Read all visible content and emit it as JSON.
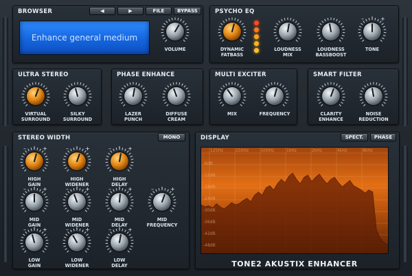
{
  "theme": {
    "accent_orange": "#f3961c",
    "screen_blue": "#1f76f0",
    "panel_dark": "#22282e"
  },
  "browser": {
    "title": "BROWSER",
    "prev_label": "◀",
    "next_label": "▶",
    "file_label": "FILE",
    "bypass_label": "BYPASS",
    "preset_name": "Enhance general medium",
    "volume_label": "VOLUME"
  },
  "psycho_eq": {
    "title": "PSYCHO EQ",
    "knobs": [
      "DYNAMIC\nFATBASS",
      "LOUDNESS\nMIX",
      "LOUDNESS\nBASSBOOST",
      "TONE"
    ]
  },
  "ultra_stereo": {
    "title": "ULTRA STEREO",
    "knobs": [
      "VIRTUAL\nSURROUND",
      "SILKY\nSURROUND"
    ]
  },
  "phase_enhance": {
    "title": "PHASE ENHANCE",
    "knobs": [
      "LAZER\nPUNCH",
      "DIFFUSE\nCREAM"
    ]
  },
  "multi_exciter": {
    "title": "MULTI EXCITER",
    "knobs": [
      "MIX",
      "FREQUENCY"
    ]
  },
  "smart_filter": {
    "title": "SMART FILTER",
    "knobs": [
      "CLARITY\nENHANCE",
      "NOISE\nREDUCTION"
    ]
  },
  "stereo_width": {
    "title": "STEREO WIDTH",
    "mono_label": "MONO",
    "knobs": [
      "HIGH\nGAIN",
      "HIGH\nWIDENER",
      "HIGH\nDELAY",
      "MID\nGAIN",
      "MID\nWIDENER",
      "MID\nDELAY",
      "MID\nFREQUENCY",
      "LOW\nGAIN",
      "LOW\nWIDENER",
      "LOW\nDELAY"
    ]
  },
  "display": {
    "title": "DISPLAY",
    "spect_label": "SPECT.",
    "phase_label": "PHASE",
    "freq_labels": [
      "125Hz",
      "250Hz",
      "500Hz",
      "1kHz",
      "2kHz",
      "4kHz",
      "8kHz"
    ],
    "db_labels": [
      "-6dB",
      "-12dB",
      "-18dB",
      "-24dB",
      "-30dB",
      "-36dB",
      "-42dB",
      "-48dB"
    ],
    "spectrum_levels": [
      0.46,
      0.44,
      0.45,
      0.43,
      0.47,
      0.44,
      0.42,
      0.45,
      0.48,
      0.46,
      0.47,
      0.5,
      0.52,
      0.49,
      0.55,
      0.58,
      0.55,
      0.62,
      0.64,
      0.6,
      0.66,
      0.7,
      0.67,
      0.73,
      0.76,
      0.7,
      0.66,
      0.72,
      0.74,
      0.68,
      0.72,
      0.75,
      0.7,
      0.66,
      0.7,
      0.72,
      0.67,
      0.63,
      0.66,
      0.69,
      0.64,
      0.62,
      0.6,
      0.57,
      0.6,
      0.58,
      0.22,
      0.14,
      0.1,
      0.08
    ]
  },
  "brand": "TONE2 AKUSTIX ENHANCER"
}
